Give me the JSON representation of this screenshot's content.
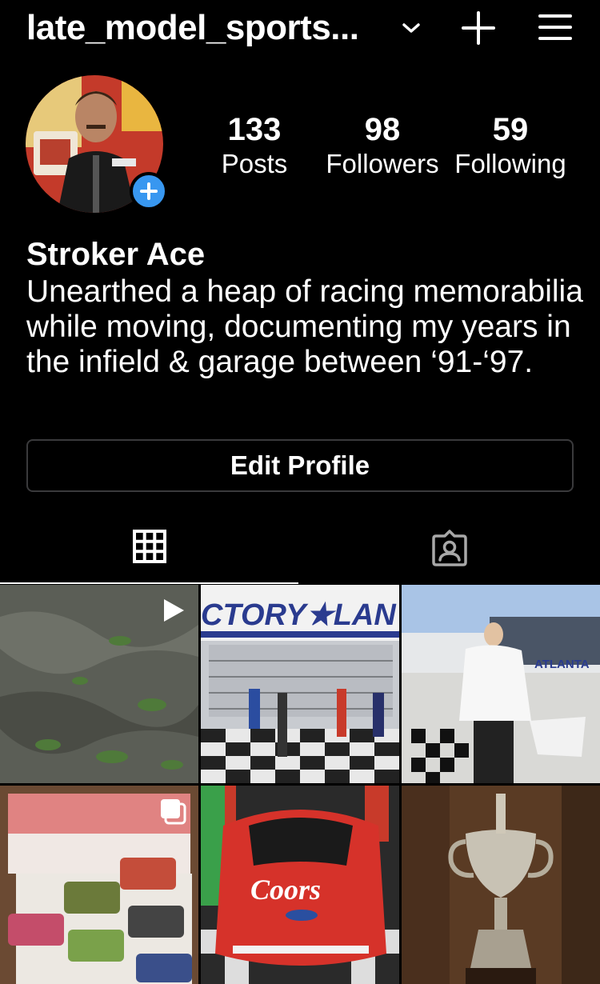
{
  "header": {
    "username": "late_model_sports...",
    "dropdown_icon": "chevron-down-icon",
    "create_icon": "plus-icon",
    "menu_icon": "hamburger-menu-icon"
  },
  "profile": {
    "stats": [
      {
        "value": "133",
        "label": "Posts"
      },
      {
        "value": "98",
        "label": "Followers"
      },
      {
        "value": "59",
        "label": "Following"
      }
    ],
    "display_name": "Stroker Ace",
    "bio": "Unearthed a heap of racing memorabilia while moving, documenting my years in the infield & garage between ‘91-‘97.",
    "edit_button_label": "Edit Profile",
    "accent_color": "#3897f0"
  },
  "tabs": [
    {
      "name": "grid",
      "icon": "grid-icon",
      "active": true
    },
    {
      "name": "tagged",
      "icon": "tagged-person-icon",
      "active": false
    }
  ],
  "posts": [
    {
      "subject": "wet ground with grass",
      "badge": "play-icon"
    },
    {
      "subject": "victory lane photo",
      "sign_text": "CTORY★LAN",
      "badge": ""
    },
    {
      "subject": "man waving checkered flag",
      "sign_text": "ATLANTA",
      "badge": ""
    },
    {
      "subject": "race car stickers",
      "badge": "carousel-icon"
    },
    {
      "subject": "red Coors race car",
      "car_text": "Coors",
      "badge": ""
    },
    {
      "subject": "silver trophy",
      "badge": ""
    }
  ]
}
